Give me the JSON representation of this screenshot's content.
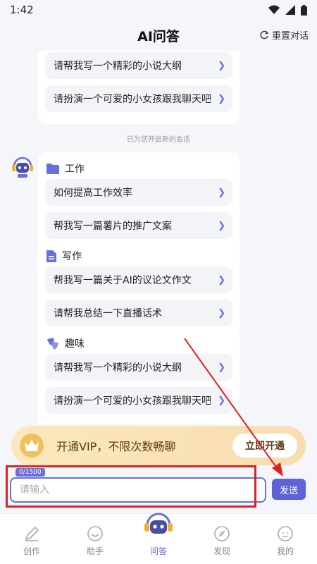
{
  "status": {
    "time": "1:42"
  },
  "header": {
    "title": "AI问答",
    "reset_label": "重置对话"
  },
  "previous_suggestions": [
    {
      "label": "请帮我写一个精彩的小说大纲"
    },
    {
      "label": "请扮演一个可爱的小女孩跟我聊天吧"
    }
  ],
  "system_note": "已为您开启新的会话",
  "sections": [
    {
      "title": "工作",
      "icon": "folder-icon",
      "items": [
        {
          "label": "如何提高工作效率"
        },
        {
          "label": "帮我写一篇薯片的推广文案"
        }
      ]
    },
    {
      "title": "写作",
      "icon": "document-icon",
      "items": [
        {
          "label": "帮我写一篇关于AI的议论文作文"
        },
        {
          "label": "请帮我总结一下直播话术"
        }
      ]
    },
    {
      "title": "趣味",
      "icon": "mask-icon",
      "items": [
        {
          "label": "请帮我写一个精彩的小说大纲"
        },
        {
          "label": "请扮演一个可爱的小女孩跟我聊天吧"
        }
      ]
    }
  ],
  "vip": {
    "text": "开通VIP，不限次数畅聊",
    "button_label": "立即开通"
  },
  "input": {
    "counter": "0/1500",
    "placeholder": "请输入",
    "send_label": "发送"
  },
  "nav": [
    {
      "label": "创作",
      "icon": "pen-icon"
    },
    {
      "label": "助手",
      "icon": "smiley-icon"
    },
    {
      "label": "问答",
      "icon": "robot-icon"
    },
    {
      "label": "发现",
      "icon": "compass-icon"
    },
    {
      "label": "我的",
      "icon": "profile-icon"
    }
  ],
  "colors": {
    "accent": "#5e63d6",
    "annotation": "#e02020",
    "vip_bg": "#fbe8bd"
  }
}
